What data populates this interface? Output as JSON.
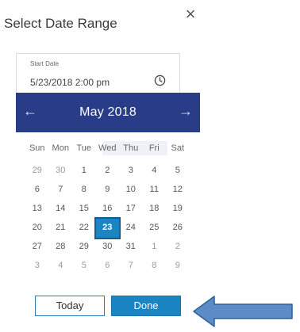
{
  "dialog": {
    "title": "Select Date Range",
    "close_icon": "close-icon"
  },
  "start": {
    "label": "Start Date",
    "value": "5/23/2018 2:00 pm",
    "icon": "clock-icon"
  },
  "calendar": {
    "month_label": "May 2018",
    "prev_icon": "arrow-left-icon",
    "next_icon": "arrow-right-icon",
    "weekdays": [
      "Sun",
      "Mon",
      "Tue",
      "Wed",
      "Thu",
      "Fri",
      "Sat"
    ],
    "weeks": [
      [
        "29",
        "30",
        "1",
        "2",
        "3",
        "4",
        "5"
      ],
      [
        "6",
        "7",
        "8",
        "9",
        "10",
        "11",
        "12"
      ],
      [
        "13",
        "14",
        "15",
        "16",
        "17",
        "18",
        "19"
      ],
      [
        "20",
        "21",
        "22",
        "23",
        "24",
        "25",
        "26"
      ],
      [
        "27",
        "28",
        "29",
        "30",
        "31",
        "1",
        "2"
      ],
      [
        "3",
        "4",
        "5",
        "6",
        "7",
        "8",
        "9"
      ]
    ],
    "selected": "23"
  },
  "buttons": {
    "today": "Today",
    "done": "Done"
  },
  "colors": {
    "header": "#283c88",
    "accent": "#1b84c3",
    "arrow": "#5b8cc6"
  }
}
